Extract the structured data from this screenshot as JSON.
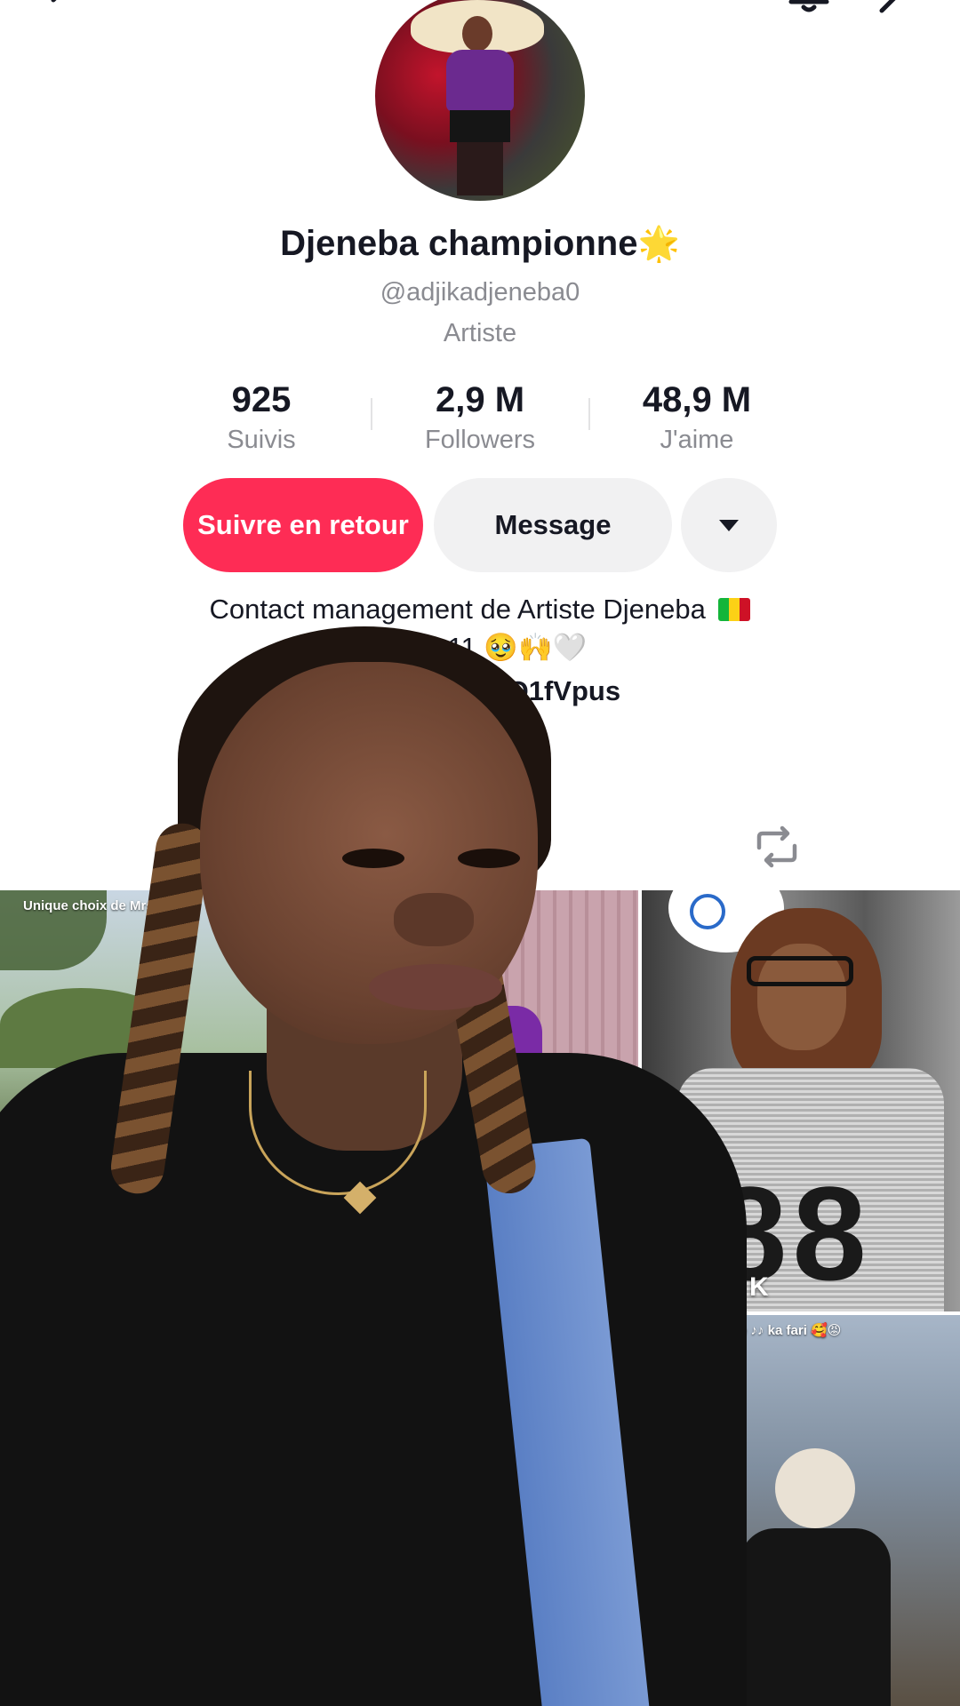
{
  "profile": {
    "display_name": "Djeneba championne",
    "name_emoji": "🌟",
    "handle": "@adjikadjeneba0",
    "category": "Artiste"
  },
  "stats": {
    "following": {
      "value": "925",
      "label": "Suivis"
    },
    "followers": {
      "value": "2,9 M",
      "label": "Followers"
    },
    "likes": {
      "value": "48,9 M",
      "label": "J'aime"
    }
  },
  "actions": {
    "follow_back": "Suivre en retour",
    "message": "Message"
  },
  "bio": {
    "line1": "Contact management de Artiste Djeneba",
    "line2": "74 11 11 🥹🙌🤍",
    "link": "at.com/t/aQ1fVpus",
    "extra": "E"
  },
  "videos": [
    {
      "caption": "Unique choix de Mrs 🙈❤️"
    },
    {
      "views": "8 K"
    },
    {
      "caption": "e ♪♪ ka fari 🥰😡"
    }
  ],
  "colors": {
    "accent": "#fe2c55",
    "secondary_button": "#f1f1f2",
    "muted_text": "#8a8b91",
    "primary_text": "#161823"
  },
  "icons": {
    "top_bar": [
      "back-icon",
      "bell-icon",
      "share-icon"
    ],
    "tabs": [
      "music-icon",
      "repost-icon"
    ],
    "link": "link-icon",
    "dropdown": "caret-down-icon"
  }
}
